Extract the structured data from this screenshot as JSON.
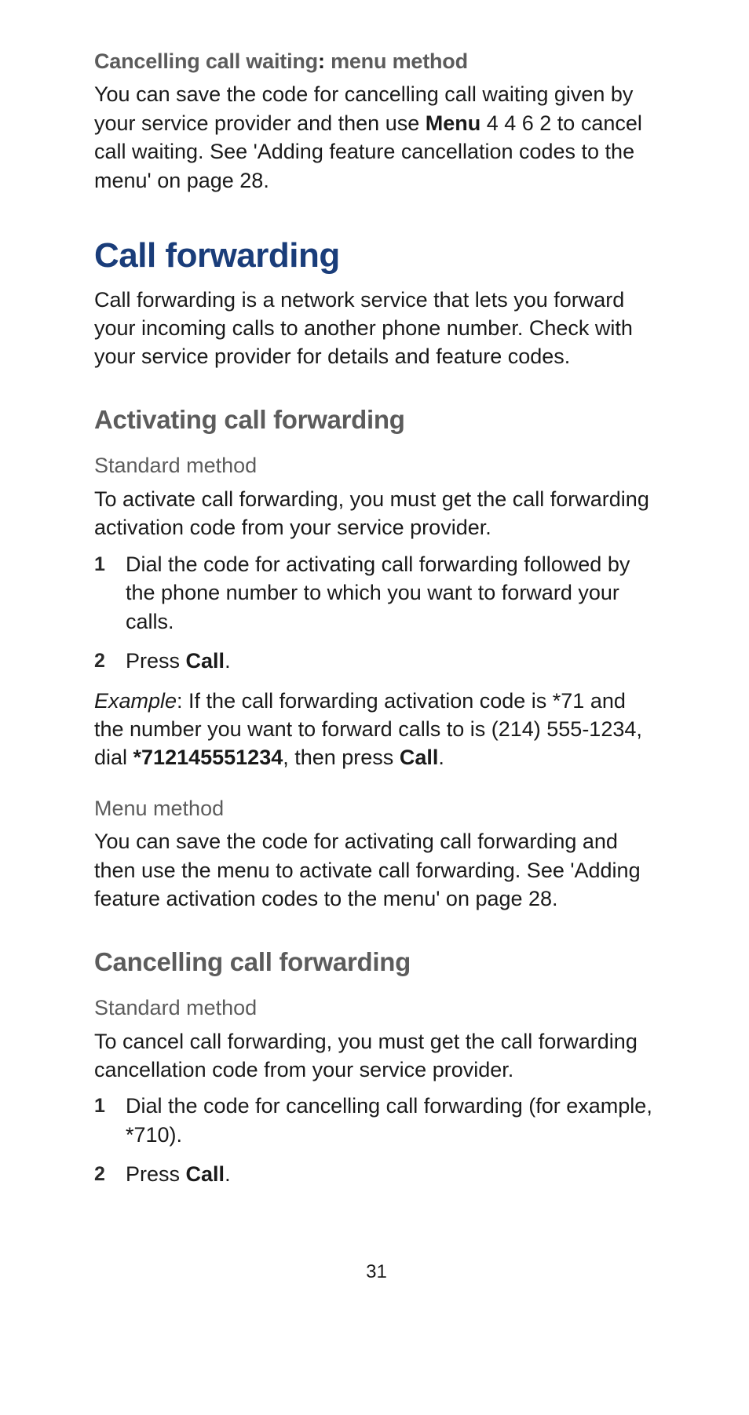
{
  "section1": {
    "heading_prefix": "Cancelling call waiting",
    "heading_sep": ": ",
    "heading_suffix": "menu method",
    "p1a": "You can save the code for cancelling call waiting given by your service provider and then use ",
    "p1_menu": "Menu",
    "p1b": " 4 4 6 2 to cancel call waiting. See 'Adding feature cancellation codes to the menu' on page 28."
  },
  "cf": {
    "title": "Call forwarding",
    "intro": "Call forwarding is a network service that lets you forward your incoming calls to another phone number. Check with your service provider for details and feature codes."
  },
  "activate": {
    "title": "Activating call forwarding",
    "standard_label": "Standard method",
    "standard_intro": "To activate call forwarding, you must get the call forwarding activation code from your service provider.",
    "step1_num": "1",
    "step1": "Dial the code for activating call forwarding followed by the phone number to which you want to forward your calls.",
    "step2_num": "2",
    "step2a": "Press ",
    "step2b": "Call",
    "step2c": ".",
    "example_label": "Example",
    "example_a": ":  If the call forwarding activation code is *71 and the number you want to forward calls to is (214) 555-1234, dial ",
    "example_code": "*712145551234",
    "example_b": ", then press ",
    "example_call": "Call",
    "example_c": ".",
    "menu_label": "Menu method",
    "menu_para": "You can save the code for activating call forwarding and then use the menu to activate call forwarding. See 'Adding feature activation codes to the menu' on page 28."
  },
  "cancel": {
    "title": "Cancelling call forwarding",
    "standard_label": "Standard method",
    "standard_intro": "To cancel call forwarding, you must get the call forwarding cancellation code from your service provider.",
    "step1_num": "1",
    "step1": "Dial the code for cancelling call forwarding (for example, *710).",
    "step2_num": "2",
    "step2a": "Press ",
    "step2b": "Call",
    "step2c": "."
  },
  "page_number": "31"
}
